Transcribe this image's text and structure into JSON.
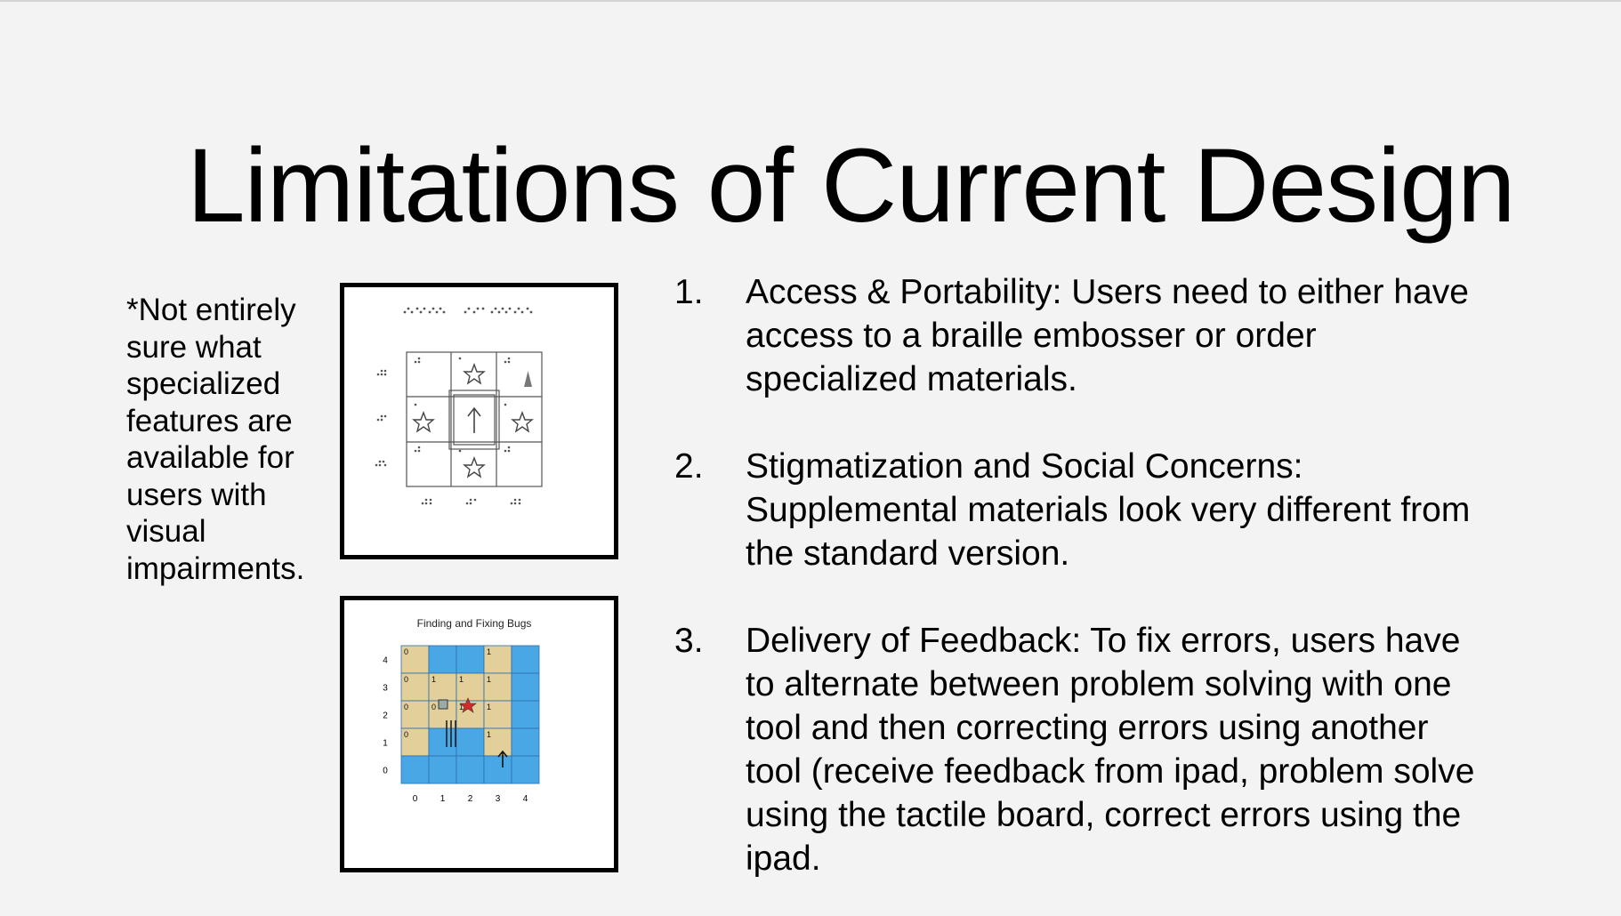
{
  "slide": {
    "title": "Limitations of Current Design",
    "note": "*Not entirely sure what specialized features are available for users with visual impairments."
  },
  "figures": {
    "braille_board": {
      "description_icons": [
        "star-icon",
        "arrow-up-icon",
        "triangle-icon",
        "wall-icon"
      ]
    },
    "bug_board": {
      "title": "Finding and Fixing Bugs",
      "x_labels": [
        "0",
        "1",
        "2",
        "3",
        "4"
      ],
      "y_labels": [
        "4",
        "3",
        "2",
        "1",
        "0"
      ],
      "cell_numbers": [
        {
          "row": 0,
          "col": 0,
          "text": "0"
        },
        {
          "row": 0,
          "col": 3,
          "text": "1"
        },
        {
          "row": 1,
          "col": 0,
          "text": "0"
        },
        {
          "row": 1,
          "col": 1,
          "text": "1"
        },
        {
          "row": 1,
          "col": 2,
          "text": "1"
        },
        {
          "row": 1,
          "col": 3,
          "text": "1"
        },
        {
          "row": 2,
          "col": 0,
          "text": "0"
        },
        {
          "row": 2,
          "col": 1,
          "text": "0"
        },
        {
          "row": 2,
          "col": 2,
          "text": "1"
        },
        {
          "row": 2,
          "col": 3,
          "text": "1"
        },
        {
          "row": 3,
          "col": 0,
          "text": "0"
        },
        {
          "row": 3,
          "col": 3,
          "text": "1"
        }
      ],
      "colors": {
        "sand": "#e3cf99",
        "water": "#4aa7e6",
        "star": "#d42a2a"
      }
    }
  },
  "points": [
    {
      "number": "1.",
      "text": "Access & Portability: Users need to either have access to a braille embosser or order specialized materials."
    },
    {
      "number": "2.",
      "text": "Stigmatization and Social Concerns: Supplemental materials look very different from the standard version."
    },
    {
      "number": "3.",
      "text": "Delivery of Feedback: To fix errors, users have to alternate between problem solving with one tool and then correcting errors using another tool (receive feedback from ipad, problem solve using the tactile board, correct errors using the ipad."
    }
  ]
}
